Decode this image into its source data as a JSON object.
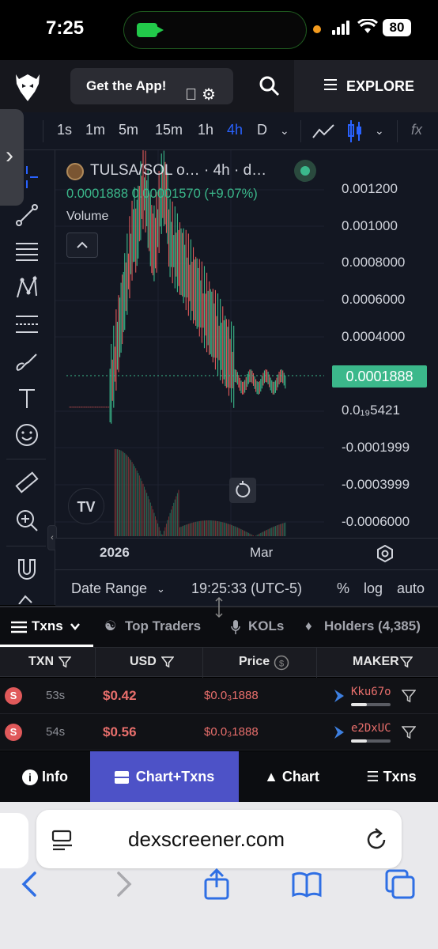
{
  "status_bar": {
    "time": "7:25",
    "battery": "80"
  },
  "header": {
    "get_app": "Get the App!",
    "explore": "EXPLORE"
  },
  "toolbar": {
    "timeframes": [
      "1s",
      "1m",
      "5m",
      "15m",
      "1h",
      "4h",
      "D"
    ],
    "active_timeframe": "4h",
    "fx": "fx"
  },
  "chart": {
    "symbol": "TULSA/SOL o… · 4h · d…",
    "ohlc": "0.0001888  0.00001570 (+9.07%)",
    "volume_label": "Volume",
    "price_labels": [
      "0.001200",
      "0.001000",
      "0.0008000",
      "0.0006000",
      "0.0004000",
      "0.0₁₉5421",
      "-0.0001999",
      "-0.0003999",
      "-0.0006000"
    ],
    "current_price": "0.0001888",
    "time_labels": [
      "2026",
      "Mar"
    ],
    "tv_logo": "TV",
    "bottom": {
      "date_range": "Date Range",
      "time": "19:25:33 (UTC-5)",
      "percent": "%",
      "log": "log",
      "auto": "auto"
    }
  },
  "tabs": [
    "Txns",
    "Top Traders",
    "KOLs",
    "Holders (4,385)"
  ],
  "table": {
    "headers": [
      "TXN",
      "USD",
      "Price",
      "MAKER"
    ],
    "rows": [
      {
        "type": "S",
        "age": "53s",
        "usd": "$0.42",
        "price": "$0.0₃1888",
        "maker": "Kku67o",
        "holding_fraction": 0.4
      },
      {
        "type": "S",
        "age": "54s",
        "usd": "$0.56",
        "price": "$0.0₃1888",
        "maker": "e2DxUC",
        "holding_fraction": 0.4
      }
    ]
  },
  "bottom_nav": [
    "Info",
    "Chart+Txns",
    "Chart",
    "Txns"
  ],
  "bottom_nav_active": "Chart+Txns",
  "safari": {
    "url": "dexscreener.com"
  },
  "colors": {
    "accent": "#2962ff",
    "up": "#3bb88b",
    "down": "#e0595a",
    "nav_active": "#4d52c7"
  }
}
